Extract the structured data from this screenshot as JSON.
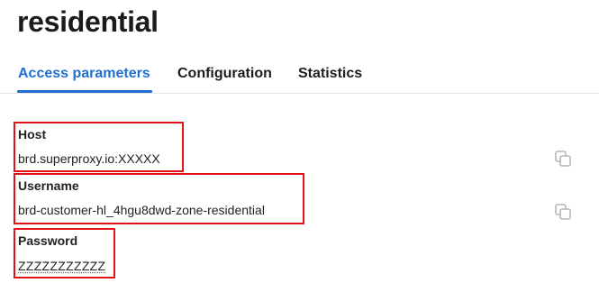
{
  "page": {
    "title": "residential"
  },
  "tabs": [
    {
      "label": "Access parameters",
      "active": true
    },
    {
      "label": "Configuration",
      "active": false
    },
    {
      "label": "Statistics",
      "active": false
    }
  ],
  "fields": {
    "host": {
      "label": "Host",
      "value": "brd.superproxy.io:XXXXX"
    },
    "username": {
      "label": "Username",
      "value": "brd-customer-hl_4hgu8dwd-zone-residential"
    },
    "password": {
      "label": "Password",
      "value": "ZZZZZZZZZZZ"
    }
  },
  "icons": {
    "copy_host": "copy-icon",
    "copy_username": "copy-icon"
  },
  "colors": {
    "accent": "#1f6fd1",
    "highlight_border": "#e2121b",
    "icon_gray": "#b3b8c0"
  }
}
